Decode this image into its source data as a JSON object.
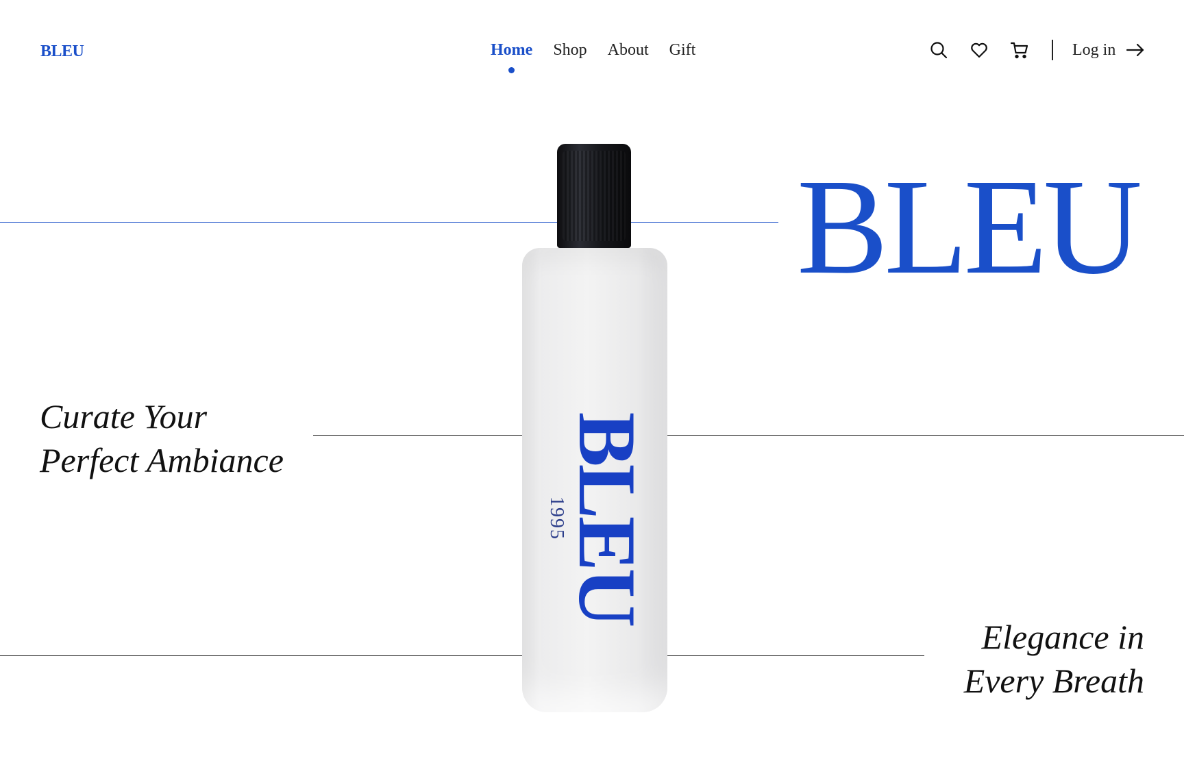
{
  "header": {
    "logo": "BLEU",
    "nav": [
      {
        "label": "Home",
        "active": true
      },
      {
        "label": "Shop",
        "active": false
      },
      {
        "label": "About",
        "active": false
      },
      {
        "label": "Gift",
        "active": false
      }
    ],
    "icons": [
      "search-icon",
      "heart-icon",
      "cart-icon",
      "arrow-right-icon"
    ],
    "login_label": "Log in"
  },
  "hero": {
    "brand": "BLEU",
    "tagline_left": [
      "Curate Your",
      "Perfect Ambiance"
    ],
    "tagline_right": [
      "Elegance in",
      "Every Breath"
    ],
    "bottle_label": "BLEU",
    "bottle_year": "1995"
  },
  "colors": {
    "accent": "#1a4fc9",
    "text": "#111111",
    "background": "#ffffff"
  }
}
